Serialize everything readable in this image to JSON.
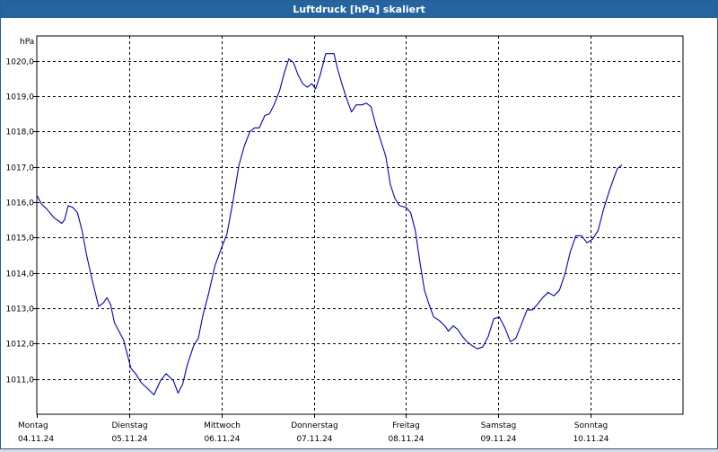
{
  "window": {
    "title": "Luftdruck [hPa] skaliert"
  },
  "colors": {
    "titlebar": "#24649f",
    "title_text": "#ffffff",
    "line": "#0000cc",
    "grid": "#000000",
    "background": "#ffffff"
  },
  "chart_data": {
    "type": "line",
    "title": "Luftdruck [hPa] skaliert",
    "ylabel": "hPa",
    "xlabel": "",
    "ylim": [
      1010.0,
      1020.7
    ],
    "yticks": [
      "1011,0",
      "1012,0",
      "1013,0",
      "1014,0",
      "1015,0",
      "1016,0",
      "1017,0",
      "1018,0",
      "1019,0",
      "1020,0"
    ],
    "ytick_values": [
      1011,
      1012,
      1013,
      1014,
      1015,
      1016,
      1017,
      1018,
      1019,
      1020
    ],
    "xlim_days": [
      0,
      7
    ],
    "xticks": [
      {
        "day": "Montag",
        "date": "04.11.24"
      },
      {
        "day": "Dienstag",
        "date": "05.11.24"
      },
      {
        "day": "Mittwoch",
        "date": "06.11.24"
      },
      {
        "day": "Donnerstag",
        "date": "07.11.24"
      },
      {
        "day": "Freitag",
        "date": "08.11.24"
      },
      {
        "day": "Samstag",
        "date": "09.11.24"
      },
      {
        "day": "Sonntag",
        "date": "10.11.24"
      }
    ],
    "grid": true,
    "series": [
      {
        "values": [
          [
            0.0,
            1016.2
          ],
          [
            0.05,
            1015.95
          ],
          [
            0.11,
            1015.8
          ],
          [
            0.19,
            1015.55
          ],
          [
            0.27,
            1015.4
          ],
          [
            0.3,
            1015.5
          ],
          [
            0.34,
            1015.9
          ],
          [
            0.39,
            1015.85
          ],
          [
            0.44,
            1015.7
          ],
          [
            0.49,
            1015.2
          ],
          [
            0.54,
            1014.5
          ],
          [
            0.6,
            1013.8
          ],
          [
            0.67,
            1013.05
          ],
          [
            0.72,
            1013.15
          ],
          [
            0.76,
            1013.3
          ],
          [
            0.8,
            1013.1
          ],
          [
            0.84,
            1012.6
          ],
          [
            0.89,
            1012.35
          ],
          [
            0.94,
            1012.1
          ],
          [
            0.98,
            1011.7
          ],
          [
            1.02,
            1011.3
          ],
          [
            1.07,
            1011.15
          ],
          [
            1.13,
            1010.9
          ],
          [
            1.21,
            1010.7
          ],
          [
            1.27,
            1010.55
          ],
          [
            1.34,
            1010.95
          ],
          [
            1.4,
            1011.15
          ],
          [
            1.48,
            1010.95
          ],
          [
            1.53,
            1010.6
          ],
          [
            1.58,
            1010.85
          ],
          [
            1.63,
            1011.4
          ],
          [
            1.7,
            1011.95
          ],
          [
            1.75,
            1012.15
          ],
          [
            1.8,
            1012.8
          ],
          [
            1.86,
            1013.4
          ],
          [
            1.93,
            1014.2
          ],
          [
            2.0,
            1014.7
          ],
          [
            2.06,
            1015.1
          ],
          [
            2.13,
            1016.1
          ],
          [
            2.19,
            1017.05
          ],
          [
            2.25,
            1017.6
          ],
          [
            2.31,
            1018.0
          ],
          [
            2.36,
            1018.1
          ],
          [
            2.41,
            1018.1
          ],
          [
            2.47,
            1018.45
          ],
          [
            2.52,
            1018.5
          ],
          [
            2.57,
            1018.75
          ],
          [
            2.63,
            1019.15
          ],
          [
            2.68,
            1019.65
          ],
          [
            2.73,
            1020.05
          ],
          [
            2.78,
            1019.95
          ],
          [
            2.83,
            1019.6
          ],
          [
            2.88,
            1019.35
          ],
          [
            2.93,
            1019.25
          ],
          [
            2.98,
            1019.35
          ],
          [
            3.02,
            1019.2
          ],
          [
            3.07,
            1019.6
          ],
          [
            3.13,
            1020.2
          ],
          [
            3.17,
            1020.2
          ],
          [
            3.22,
            1020.2
          ],
          [
            3.26,
            1019.75
          ],
          [
            3.31,
            1019.3
          ],
          [
            3.36,
            1018.9
          ],
          [
            3.41,
            1018.55
          ],
          [
            3.46,
            1018.75
          ],
          [
            3.52,
            1018.75
          ],
          [
            3.57,
            1018.8
          ],
          [
            3.62,
            1018.7
          ],
          [
            3.67,
            1018.2
          ],
          [
            3.73,
            1017.7
          ],
          [
            3.78,
            1017.3
          ],
          [
            3.83,
            1016.5
          ],
          [
            3.88,
            1016.1
          ],
          [
            3.93,
            1015.9
          ],
          [
            4.0,
            1015.85
          ],
          [
            4.05,
            1015.7
          ],
          [
            4.1,
            1015.2
          ],
          [
            4.15,
            1014.3
          ],
          [
            4.2,
            1013.5
          ],
          [
            4.25,
            1013.1
          ],
          [
            4.3,
            1012.75
          ],
          [
            4.36,
            1012.65
          ],
          [
            4.42,
            1012.5
          ],
          [
            4.46,
            1012.35
          ],
          [
            4.51,
            1012.5
          ],
          [
            4.56,
            1012.4
          ],
          [
            4.61,
            1012.2
          ],
          [
            4.66,
            1012.05
          ],
          [
            4.71,
            1011.95
          ],
          [
            4.77,
            1011.85
          ],
          [
            4.83,
            1011.9
          ],
          [
            4.89,
            1012.2
          ],
          [
            4.95,
            1012.7
          ],
          [
            5.01,
            1012.75
          ],
          [
            5.07,
            1012.45
          ],
          [
            5.13,
            1012.05
          ],
          [
            5.19,
            1012.15
          ],
          [
            5.25,
            1012.55
          ],
          [
            5.31,
            1012.95
          ],
          [
            5.37,
            1012.95
          ],
          [
            5.42,
            1013.1
          ],
          [
            5.48,
            1013.3
          ],
          [
            5.54,
            1013.45
          ],
          [
            5.6,
            1013.35
          ],
          [
            5.66,
            1013.5
          ],
          [
            5.72,
            1013.95
          ],
          [
            5.78,
            1014.6
          ],
          [
            5.84,
            1015.05
          ],
          [
            5.9,
            1015.05
          ],
          [
            5.96,
            1014.85
          ],
          [
            6.02,
            1014.95
          ],
          [
            6.08,
            1015.2
          ],
          [
            6.14,
            1015.8
          ],
          [
            6.2,
            1016.3
          ],
          [
            6.26,
            1016.75
          ],
          [
            6.29,
            1016.95
          ],
          [
            6.34,
            1017.05
          ]
        ]
      }
    ]
  }
}
